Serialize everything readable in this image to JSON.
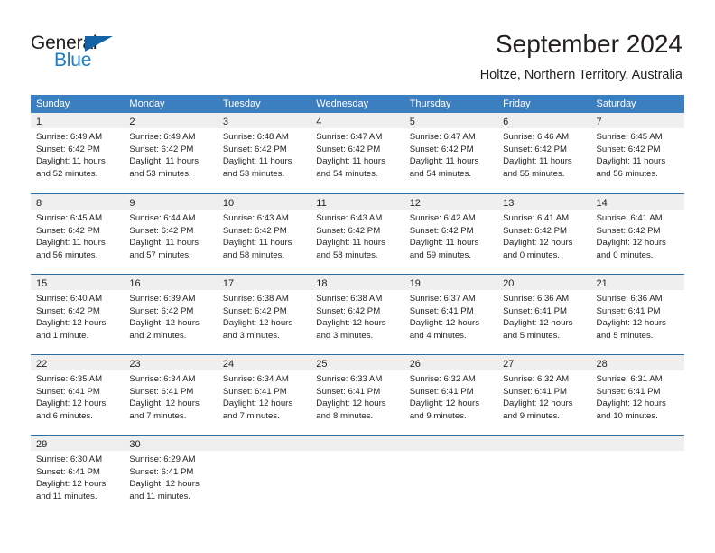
{
  "branding": {
    "logo_primary": "General",
    "logo_secondary": "Blue",
    "accent_color": "#1f7ec4",
    "triangle_color": "#1464a5"
  },
  "header": {
    "title": "September 2024",
    "subtitle": "Holtze, Northern Territory, Australia"
  },
  "calendar": {
    "header_bg": "#3c7fc1",
    "header_text_color": "#ffffff",
    "daynum_band_color": "#efefef",
    "row_border_color": "#2e6da4",
    "weekdays": [
      "Sunday",
      "Monday",
      "Tuesday",
      "Wednesday",
      "Thursday",
      "Friday",
      "Saturday"
    ],
    "weeks": [
      [
        {
          "day": "1",
          "sunrise": "Sunrise: 6:49 AM",
          "sunset": "Sunset: 6:42 PM",
          "daylight_line1": "Daylight: 11 hours",
          "daylight_line2": "and 52 minutes."
        },
        {
          "day": "2",
          "sunrise": "Sunrise: 6:49 AM",
          "sunset": "Sunset: 6:42 PM",
          "daylight_line1": "Daylight: 11 hours",
          "daylight_line2": "and 53 minutes."
        },
        {
          "day": "3",
          "sunrise": "Sunrise: 6:48 AM",
          "sunset": "Sunset: 6:42 PM",
          "daylight_line1": "Daylight: 11 hours",
          "daylight_line2": "and 53 minutes."
        },
        {
          "day": "4",
          "sunrise": "Sunrise: 6:47 AM",
          "sunset": "Sunset: 6:42 PM",
          "daylight_line1": "Daylight: 11 hours",
          "daylight_line2": "and 54 minutes."
        },
        {
          "day": "5",
          "sunrise": "Sunrise: 6:47 AM",
          "sunset": "Sunset: 6:42 PM",
          "daylight_line1": "Daylight: 11 hours",
          "daylight_line2": "and 54 minutes."
        },
        {
          "day": "6",
          "sunrise": "Sunrise: 6:46 AM",
          "sunset": "Sunset: 6:42 PM",
          "daylight_line1": "Daylight: 11 hours",
          "daylight_line2": "and 55 minutes."
        },
        {
          "day": "7",
          "sunrise": "Sunrise: 6:45 AM",
          "sunset": "Sunset: 6:42 PM",
          "daylight_line1": "Daylight: 11 hours",
          "daylight_line2": "and 56 minutes."
        }
      ],
      [
        {
          "day": "8",
          "sunrise": "Sunrise: 6:45 AM",
          "sunset": "Sunset: 6:42 PM",
          "daylight_line1": "Daylight: 11 hours",
          "daylight_line2": "and 56 minutes."
        },
        {
          "day": "9",
          "sunrise": "Sunrise: 6:44 AM",
          "sunset": "Sunset: 6:42 PM",
          "daylight_line1": "Daylight: 11 hours",
          "daylight_line2": "and 57 minutes."
        },
        {
          "day": "10",
          "sunrise": "Sunrise: 6:43 AM",
          "sunset": "Sunset: 6:42 PM",
          "daylight_line1": "Daylight: 11 hours",
          "daylight_line2": "and 58 minutes."
        },
        {
          "day": "11",
          "sunrise": "Sunrise: 6:43 AM",
          "sunset": "Sunset: 6:42 PM",
          "daylight_line1": "Daylight: 11 hours",
          "daylight_line2": "and 58 minutes."
        },
        {
          "day": "12",
          "sunrise": "Sunrise: 6:42 AM",
          "sunset": "Sunset: 6:42 PM",
          "daylight_line1": "Daylight: 11 hours",
          "daylight_line2": "and 59 minutes."
        },
        {
          "day": "13",
          "sunrise": "Sunrise: 6:41 AM",
          "sunset": "Sunset: 6:42 PM",
          "daylight_line1": "Daylight: 12 hours",
          "daylight_line2": "and 0 minutes."
        },
        {
          "day": "14",
          "sunrise": "Sunrise: 6:41 AM",
          "sunset": "Sunset: 6:42 PM",
          "daylight_line1": "Daylight: 12 hours",
          "daylight_line2": "and 0 minutes."
        }
      ],
      [
        {
          "day": "15",
          "sunrise": "Sunrise: 6:40 AM",
          "sunset": "Sunset: 6:42 PM",
          "daylight_line1": "Daylight: 12 hours",
          "daylight_line2": "and 1 minute."
        },
        {
          "day": "16",
          "sunrise": "Sunrise: 6:39 AM",
          "sunset": "Sunset: 6:42 PM",
          "daylight_line1": "Daylight: 12 hours",
          "daylight_line2": "and 2 minutes."
        },
        {
          "day": "17",
          "sunrise": "Sunrise: 6:38 AM",
          "sunset": "Sunset: 6:42 PM",
          "daylight_line1": "Daylight: 12 hours",
          "daylight_line2": "and 3 minutes."
        },
        {
          "day": "18",
          "sunrise": "Sunrise: 6:38 AM",
          "sunset": "Sunset: 6:42 PM",
          "daylight_line1": "Daylight: 12 hours",
          "daylight_line2": "and 3 minutes."
        },
        {
          "day": "19",
          "sunrise": "Sunrise: 6:37 AM",
          "sunset": "Sunset: 6:41 PM",
          "daylight_line1": "Daylight: 12 hours",
          "daylight_line2": "and 4 minutes."
        },
        {
          "day": "20",
          "sunrise": "Sunrise: 6:36 AM",
          "sunset": "Sunset: 6:41 PM",
          "daylight_line1": "Daylight: 12 hours",
          "daylight_line2": "and 5 minutes."
        },
        {
          "day": "21",
          "sunrise": "Sunrise: 6:36 AM",
          "sunset": "Sunset: 6:41 PM",
          "daylight_line1": "Daylight: 12 hours",
          "daylight_line2": "and 5 minutes."
        }
      ],
      [
        {
          "day": "22",
          "sunrise": "Sunrise: 6:35 AM",
          "sunset": "Sunset: 6:41 PM",
          "daylight_line1": "Daylight: 12 hours",
          "daylight_line2": "and 6 minutes."
        },
        {
          "day": "23",
          "sunrise": "Sunrise: 6:34 AM",
          "sunset": "Sunset: 6:41 PM",
          "daylight_line1": "Daylight: 12 hours",
          "daylight_line2": "and 7 minutes."
        },
        {
          "day": "24",
          "sunrise": "Sunrise: 6:34 AM",
          "sunset": "Sunset: 6:41 PM",
          "daylight_line1": "Daylight: 12 hours",
          "daylight_line2": "and 7 minutes."
        },
        {
          "day": "25",
          "sunrise": "Sunrise: 6:33 AM",
          "sunset": "Sunset: 6:41 PM",
          "daylight_line1": "Daylight: 12 hours",
          "daylight_line2": "and 8 minutes."
        },
        {
          "day": "26",
          "sunrise": "Sunrise: 6:32 AM",
          "sunset": "Sunset: 6:41 PM",
          "daylight_line1": "Daylight: 12 hours",
          "daylight_line2": "and 9 minutes."
        },
        {
          "day": "27",
          "sunrise": "Sunrise: 6:32 AM",
          "sunset": "Sunset: 6:41 PM",
          "daylight_line1": "Daylight: 12 hours",
          "daylight_line2": "and 9 minutes."
        },
        {
          "day": "28",
          "sunrise": "Sunrise: 6:31 AM",
          "sunset": "Sunset: 6:41 PM",
          "daylight_line1": "Daylight: 12 hours",
          "daylight_line2": "and 10 minutes."
        }
      ],
      [
        {
          "day": "29",
          "sunrise": "Sunrise: 6:30 AM",
          "sunset": "Sunset: 6:41 PM",
          "daylight_line1": "Daylight: 12 hours",
          "daylight_line2": "and 11 minutes."
        },
        {
          "day": "30",
          "sunrise": "Sunrise: 6:29 AM",
          "sunset": "Sunset: 6:41 PM",
          "daylight_line1": "Daylight: 12 hours",
          "daylight_line2": "and 11 minutes."
        },
        {
          "day": "",
          "sunrise": "",
          "sunset": "",
          "daylight_line1": "",
          "daylight_line2": ""
        },
        {
          "day": "",
          "sunrise": "",
          "sunset": "",
          "daylight_line1": "",
          "daylight_line2": ""
        },
        {
          "day": "",
          "sunrise": "",
          "sunset": "",
          "daylight_line1": "",
          "daylight_line2": ""
        },
        {
          "day": "",
          "sunrise": "",
          "sunset": "",
          "daylight_line1": "",
          "daylight_line2": ""
        },
        {
          "day": "",
          "sunrise": "",
          "sunset": "",
          "daylight_line1": "",
          "daylight_line2": ""
        }
      ]
    ]
  }
}
